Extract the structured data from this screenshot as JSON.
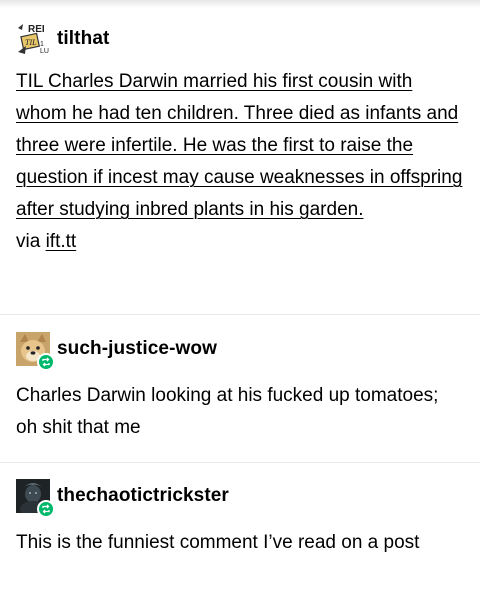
{
  "posts": [
    {
      "username": "tilthat",
      "avatar_icon": "til-reddit-logo-icon",
      "avatar_text": "REI",
      "body": "TIL Charles Darwin married his first cousin with whom he had ten children. Three died as infants and three were infertile. He was the first to raise the question if incest may cause weaknesses in offspring after studying inbred plants in his garden.",
      "via_label": "via",
      "via_link": "ift.tt"
    },
    {
      "username": "such-justice-wow",
      "avatar_icon": "doge-avatar-icon",
      "reblog_icon": "reblog-icon",
      "body": "Charles Darwin looking at his fucked up tomatoes; oh shit that me"
    },
    {
      "username": "thechaotictrickster",
      "avatar_icon": "dark-portrait-avatar-icon",
      "reblog_icon": "reblog-icon",
      "body": "This is the funniest comment I’ve read on a post"
    }
  ],
  "colors": {
    "reblog_badge": "#00b86b",
    "divider": "#e8e8e8",
    "text": "#000000"
  }
}
